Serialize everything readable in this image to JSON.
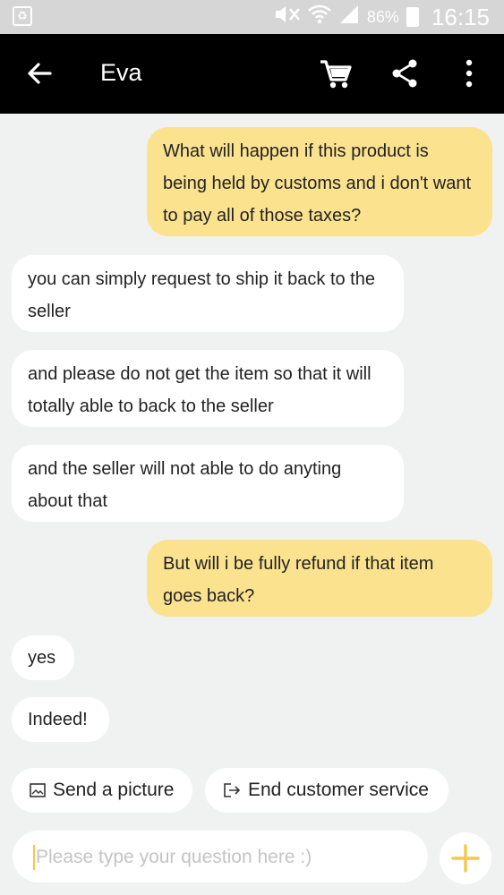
{
  "status_bar": {
    "battery": "86%",
    "time": "16:15",
    "icons": [
      "recycle-icon",
      "mute-icon",
      "wifi-icon",
      "signal-icon",
      "battery-icon"
    ]
  },
  "header": {
    "title": "Eva",
    "icons": [
      "back-arrow-icon",
      "cart-icon",
      "share-icon",
      "more-vertical-icon"
    ]
  },
  "messages": [
    {
      "from": "user",
      "text": "What will happen if this product is being held by customs and i don't want to pay all of those taxes?"
    },
    {
      "from": "agent",
      "text": "you can simply request to ship it back to the seller"
    },
    {
      "from": "agent",
      "text": "and please do not get the item so that it will totally able to back to the seller"
    },
    {
      "from": "agent",
      "text": "and the seller will not able to do anyting about that"
    },
    {
      "from": "user",
      "text": "But will i be fully refund if that item goes back?"
    },
    {
      "from": "agent",
      "text": "yes"
    },
    {
      "from": "agent",
      "text": "Indeed!"
    }
  ],
  "quick_actions": {
    "send_picture": "Send a picture",
    "end_service": "End customer service"
  },
  "input": {
    "placeholder": "Please type your question here :)",
    "value": ""
  },
  "colors": {
    "user_bubble": "#fbe28f",
    "agent_bubble": "#ffffff",
    "accent": "#f3c94a",
    "appbar": "#000000",
    "background": "#eff2f1"
  }
}
